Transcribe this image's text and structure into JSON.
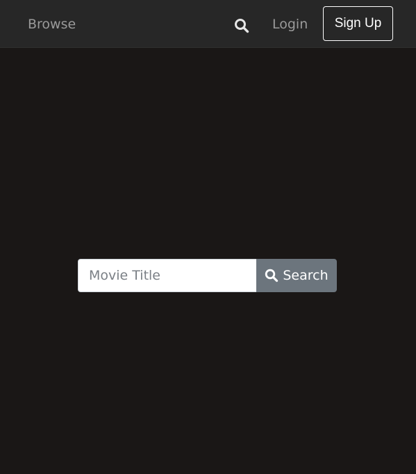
{
  "navbar": {
    "browse_label": "Browse",
    "search_icon": "search-icon",
    "login_label": "Login",
    "signup_label": "Sign Up"
  },
  "search": {
    "placeholder": "Movie Title",
    "value": "",
    "button_label": "Search",
    "button_icon": "search-icon"
  },
  "colors": {
    "page_background": "#1a1716",
    "navbar_background": "#272727",
    "nav_link": "#9a9a9a",
    "search_button": "#6c757d"
  }
}
